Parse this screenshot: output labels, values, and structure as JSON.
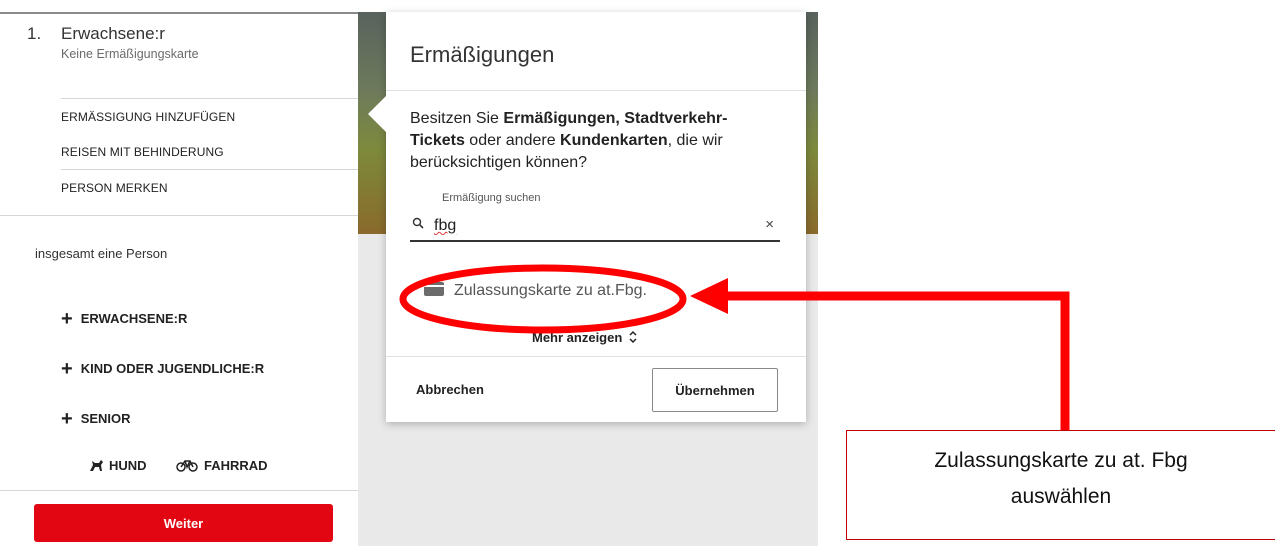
{
  "passenger": {
    "number": "1.",
    "type": "Erwachsene:r",
    "card": "Keine Ermäßigungskarte",
    "actions": [
      "ERMÄSSIGUNG HINZUFÜGEN",
      "REISEN MIT BEHINDERUNG",
      "PERSON MERKEN"
    ]
  },
  "summary": {
    "total": "insgesamt eine Person"
  },
  "add": {
    "adult": "ERWACHSENE:R",
    "child": "KIND ODER JUGENDLICHE:R",
    "senior": "SENIOR"
  },
  "extras": {
    "dog": "HUND",
    "bike": "FAHRRAD"
  },
  "continue_label": "Weiter",
  "dialog": {
    "title": "Ermäßigungen",
    "question_parts": {
      "p1": "Besitzen Sie ",
      "b1": "Ermäßigungen, Stadtverkehr-Tickets",
      "p2": " oder andere ",
      "b2": "Kundenkarten",
      "p3": ", die wir berücksichtigen können?"
    },
    "search": {
      "label": "Ermäßigung suchen",
      "value": "fbg",
      "clear": "×"
    },
    "result": "Zulassungskarte zu at.Fbg.",
    "more": "Mehr anzeigen",
    "cancel": "Abbrechen",
    "apply": "Übernehmen"
  },
  "annotation": {
    "line1": "Zulassungskarte zu at. Fbg",
    "line2": "auswählen",
    "color": "#ff0000"
  },
  "colors": {
    "primary_red": "#e20613",
    "annotation_red": "#ff0000"
  }
}
